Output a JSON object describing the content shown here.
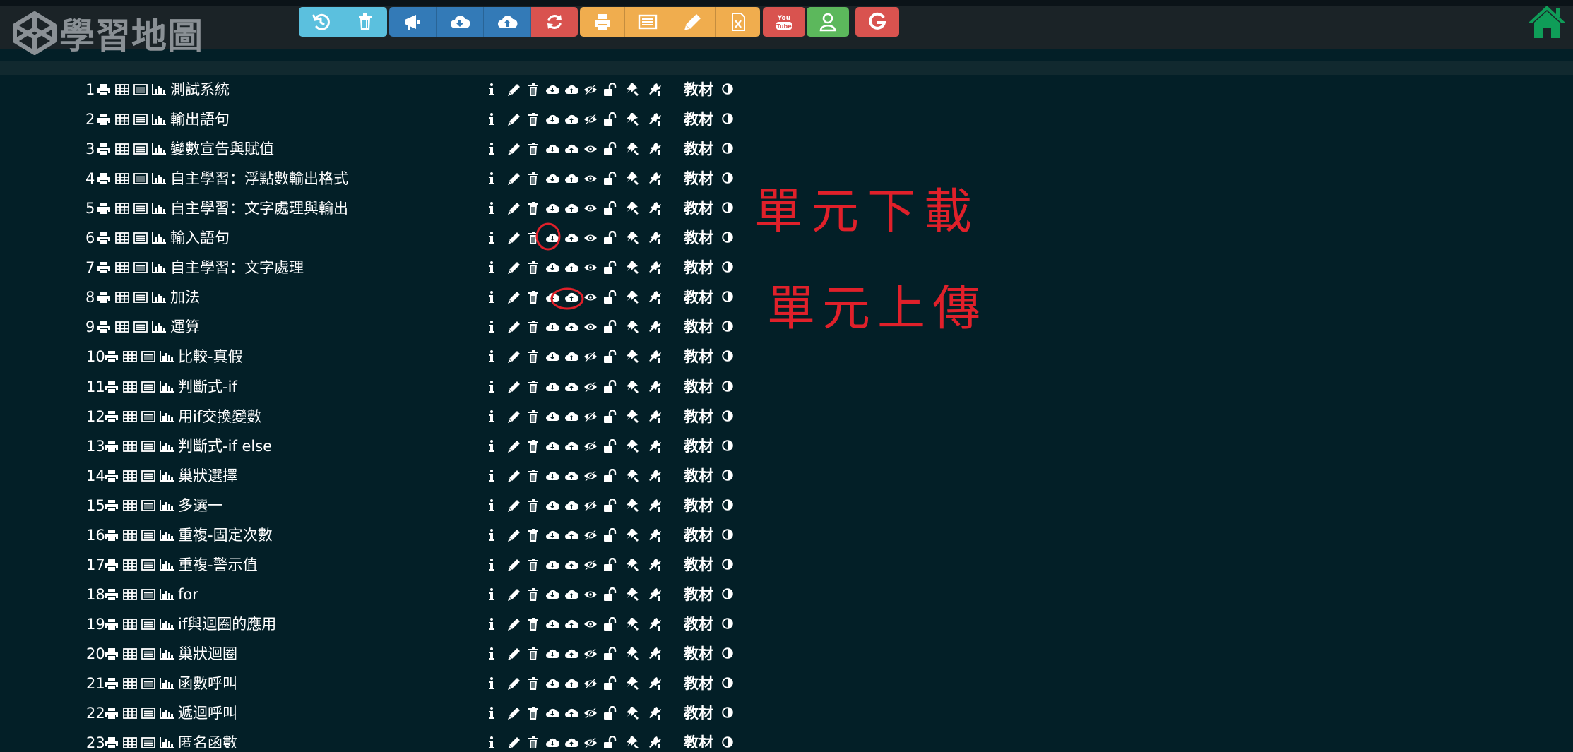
{
  "brand": {
    "name": "學習地圖",
    "logo_icon": "codepen-cube-icon"
  },
  "toolbar": {
    "groups": [
      {
        "color": "#5bc0de",
        "buttons": [
          {
            "name": "history-button",
            "icon": "history-icon"
          },
          {
            "name": "trash-button",
            "icon": "trash-icon"
          }
        ]
      },
      {
        "color": "#337ab7",
        "buttons": [
          {
            "name": "announce-button",
            "icon": "bullhorn-icon"
          },
          {
            "name": "cloud-download-button",
            "icon": "cloud-download-icon"
          },
          {
            "name": "cloud-upload-button",
            "icon": "cloud-upload-icon"
          },
          {
            "name": "refresh-button",
            "icon": "refresh-icon",
            "color": "#d9534f"
          }
        ]
      },
      {
        "color": "#f0ad4e",
        "buttons": [
          {
            "name": "print-button",
            "icon": "print-icon"
          },
          {
            "name": "list-button",
            "icon": "list-icon"
          },
          {
            "name": "edit-button",
            "icon": "pencil-icon"
          },
          {
            "name": "excel-button",
            "icon": "excel-file-icon"
          }
        ]
      },
      {
        "color": "#d9534f",
        "buttons": [
          {
            "name": "youtube-button",
            "icon": "youtube-icon"
          }
        ]
      },
      {
        "color": "#5cb85c",
        "buttons": [
          {
            "name": "user-button",
            "icon": "user-icon"
          }
        ]
      },
      {
        "color": "#d9534f",
        "buttons": [
          {
            "name": "google-button",
            "icon": "google-icon"
          }
        ]
      }
    ],
    "home_icon": "home-icon",
    "home_color": "#0f9d58"
  },
  "units": [
    {
      "num": "1",
      "title": "測試系統",
      "visibility": "hidden"
    },
    {
      "num": "2",
      "title": "輸出語句",
      "visibility": "hidden"
    },
    {
      "num": "3",
      "title": "變數宣告與賦值",
      "visibility": "visible"
    },
    {
      "num": "4",
      "title": "自主學習：浮點數輸出格式",
      "visibility": "visible"
    },
    {
      "num": "5",
      "title": "自主學習：文字處理與輸出",
      "visibility": "visible"
    },
    {
      "num": "6",
      "title": "輸入語句",
      "visibility": "visible"
    },
    {
      "num": "7",
      "title": "自主學習：文字處理",
      "visibility": "visible"
    },
    {
      "num": "8",
      "title": "加法",
      "visibility": "visible"
    },
    {
      "num": "9",
      "title": "運算",
      "visibility": "visible"
    },
    {
      "num": "10",
      "title": "比較-真假",
      "visibility": "hidden"
    },
    {
      "num": "11",
      "title": "判斷式-if",
      "visibility": "hidden"
    },
    {
      "num": "12",
      "title": "用if交換變數",
      "visibility": "hidden"
    },
    {
      "num": "13",
      "title": "判斷式-if else",
      "visibility": "hidden"
    },
    {
      "num": "14",
      "title": "巢狀選擇",
      "visibility": "hidden"
    },
    {
      "num": "15",
      "title": "多選一",
      "visibility": "hidden"
    },
    {
      "num": "16",
      "title": "重複-固定次數",
      "visibility": "hidden"
    },
    {
      "num": "17",
      "title": "重複-警示值",
      "visibility": "hidden"
    },
    {
      "num": "18",
      "title": "for",
      "visibility": "visible"
    },
    {
      "num": "19",
      "title": "if與迴圈的應用",
      "visibility": "visible"
    },
    {
      "num": "20",
      "title": "巢狀迴圈",
      "visibility": "hidden"
    },
    {
      "num": "21",
      "title": "函數呼叫",
      "visibility": "hidden"
    },
    {
      "num": "22",
      "title": "遞迴呼叫",
      "visibility": "hidden"
    },
    {
      "num": "23",
      "title": "匿名函數",
      "visibility": "hidden"
    }
  ],
  "material_label": "教材",
  "annotations": {
    "download_note": "單元下載",
    "upload_note": "單元上傳",
    "color": "#e0202a"
  }
}
